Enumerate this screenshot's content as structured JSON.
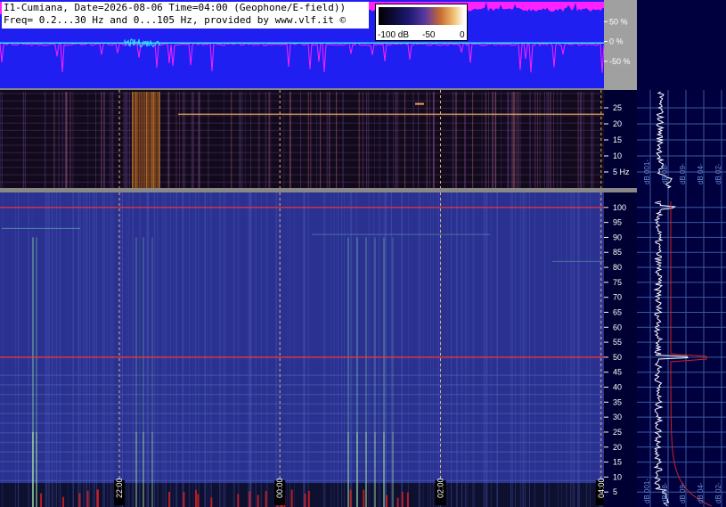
{
  "header": {
    "line1": "I1-Cumiana, Date=2026-08-06 Time=04:00 (Geophone/E-field))",
    "line2": "Freq= 0.2...30 Hz and 0...105 Hz, provided by www.vlf.it ©"
  },
  "colors": {
    "waveform_bg": "#1f1ff2",
    "waveform_trace": "#ff22ff",
    "signal_trace": "#33e6ff",
    "spectro_low_bg": "#120a1c",
    "spectro_high_bg": "#2a3190",
    "side_bg": "#00003f",
    "grid_red": "#ff3333",
    "time_marker": "#e0b070",
    "separator": "#888888"
  },
  "chart_data": [
    {
      "type": "line",
      "name": "waveform",
      "ylim": [
        -100,
        100
      ],
      "yticks": [
        "50 %",
        "0 %",
        "-50 %"
      ],
      "ytick_values": [
        50,
        0,
        -50
      ]
    },
    {
      "type": "heatmap",
      "name": "spectrogram-low",
      "ylim": [
        0,
        30
      ],
      "yticks": [
        "25",
        "20",
        "15",
        "10",
        "5 Hz"
      ],
      "ytick_values": [
        25,
        20,
        15,
        10,
        5
      ],
      "colorbar": {
        "ticks": [
          "-100 dB",
          "-50",
          "0"
        ],
        "tick_values": [
          -100,
          -50,
          0
        ]
      },
      "side_spectrum_labels": [
        "dB 001-",
        "dB 08-",
        "dB 09-",
        "dB 04-",
        "dB 02-"
      ]
    },
    {
      "type": "heatmap",
      "name": "spectrogram-high",
      "ylim": [
        0,
        105
      ],
      "yticks": [
        "100",
        "95",
        "90",
        "85",
        "80",
        "75",
        "70",
        "65",
        "60",
        "55",
        "50",
        "45",
        "40",
        "35",
        "30",
        "25",
        "20",
        "15",
        "10",
        "5"
      ],
      "ytick_values": [
        100,
        95,
        90,
        85,
        80,
        75,
        70,
        65,
        60,
        55,
        50,
        45,
        40,
        35,
        30,
        25,
        20,
        15,
        10,
        5
      ],
      "x_time_labels": [
        "22:00",
        "00:00",
        "02:00",
        "04:00"
      ],
      "x_time_positions": [
        0.1976,
        0.4634,
        0.7294,
        0.9953
      ],
      "red_lines_hz": [
        50,
        100
      ],
      "side_spectrum_labels": [
        "dB 001-",
        "dB 08-",
        "dB 09-",
        "dB 04-",
        "dB 02-"
      ]
    }
  ]
}
